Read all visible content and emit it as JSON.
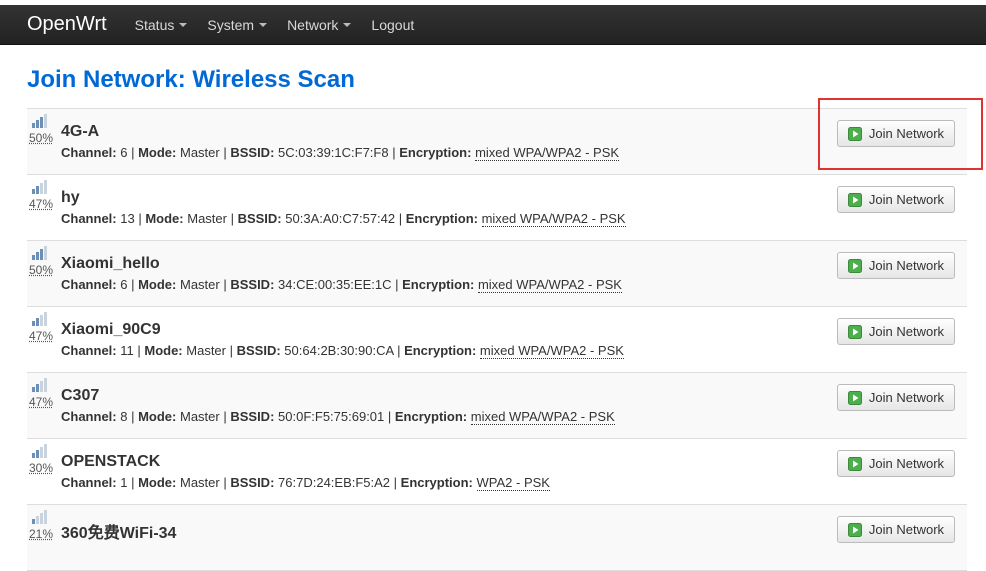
{
  "navbar": {
    "brand": "OpenWrt",
    "menu": [
      {
        "label": "Status",
        "has_caret": true
      },
      {
        "label": "System",
        "has_caret": true
      },
      {
        "label": "Network",
        "has_caret": true
      },
      {
        "label": "Logout",
        "has_caret": false
      }
    ]
  },
  "page": {
    "title": "Join Network: Wireless Scan"
  },
  "labels": {
    "channel": "Channel:",
    "mode": "Mode:",
    "bssid": "BSSID:",
    "encryption": "Encryption:",
    "join_button": "Join Network"
  },
  "networks": [
    {
      "signal": "50%",
      "ssid": "4G-A",
      "channel": "6",
      "mode": "Master",
      "bssid": "5C:03:39:1C:F7:F8",
      "encryption": "mixed WPA/WPA2 - PSK"
    },
    {
      "signal": "47%",
      "ssid": "hy",
      "channel": "13",
      "mode": "Master",
      "bssid": "50:3A:A0:C7:57:42",
      "encryption": "mixed WPA/WPA2 - PSK"
    },
    {
      "signal": "50%",
      "ssid": "Xiaomi_hello",
      "channel": "6",
      "mode": "Master",
      "bssid": "34:CE:00:35:EE:1C",
      "encryption": "mixed WPA/WPA2 - PSK"
    },
    {
      "signal": "47%",
      "ssid": "Xiaomi_90C9",
      "channel": "11",
      "mode": "Master",
      "bssid": "50:64:2B:30:90:CA",
      "encryption": "mixed WPA/WPA2 - PSK"
    },
    {
      "signal": "47%",
      "ssid": "C307",
      "channel": "8",
      "mode": "Master",
      "bssid": "50:0F:F5:75:69:01",
      "encryption": "mixed WPA/WPA2 - PSK"
    },
    {
      "signal": "30%",
      "ssid": "OPENSTACK",
      "channel": "1",
      "mode": "Master",
      "bssid": "76:7D:24:EB:F5:A2",
      "encryption": "WPA2 - PSK"
    },
    {
      "signal": "21%",
      "ssid": "360免费WiFi-34",
      "channel": "",
      "mode": "",
      "bssid": "",
      "encryption": ""
    }
  ],
  "colors": {
    "title": "#0069d6",
    "navbar": "#222222",
    "highlight": "#e0332f",
    "play_icon": "#4cae4c"
  },
  "icons": {
    "signal": "signal-bars-icon",
    "join": "play-icon",
    "caret": "caret-down-icon"
  }
}
